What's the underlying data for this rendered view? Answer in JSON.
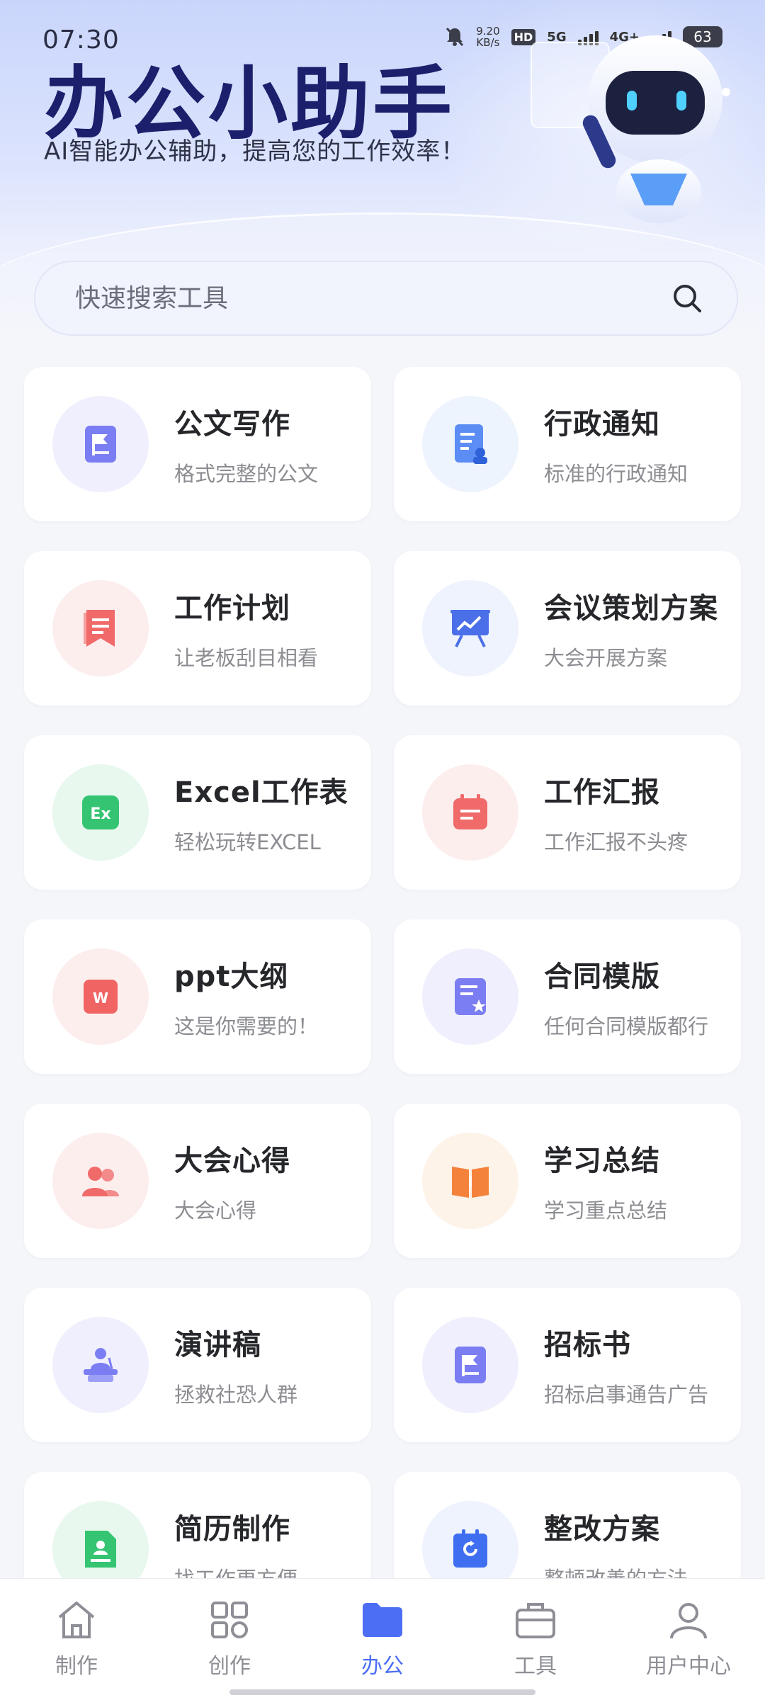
{
  "status": {
    "time": "07:30",
    "net_speed": "9.20",
    "net_unit": "KB/s",
    "hd": "HD",
    "sig1": "5G",
    "sig2": "4G+",
    "battery": "63"
  },
  "header": {
    "title": "办公小助手",
    "subtitle": "AI智能办公辅助，提高您的工作效率！"
  },
  "search": {
    "placeholder": "快速搜索工具"
  },
  "tools": [
    {
      "title": "公文写作",
      "desc": "格式完整的公文",
      "icon": "flag-doc-icon",
      "color": "#7b7df2",
      "bg": "#efeffd"
    },
    {
      "title": "行政通知",
      "desc": "标准的行政通知",
      "icon": "notice-doc-icon",
      "color": "#5b8df5",
      "bg": "#eef4fe"
    },
    {
      "title": "工作计划",
      "desc": "让老板刮目相看",
      "icon": "bookmark-icon",
      "color": "#f06a6a",
      "bg": "#fdeeee"
    },
    {
      "title": "会议策划方案",
      "desc": "大会开展方案",
      "icon": "presentation-icon",
      "color": "#4a6fe8",
      "bg": "#eef3fe"
    },
    {
      "title": "Excel工作表",
      "desc": "轻松玩转EXCEL",
      "icon": "excel-icon",
      "color": "#34c472",
      "bg": "#e8f8ee"
    },
    {
      "title": "工作汇报",
      "desc": "工作汇报不头疼",
      "icon": "report-icon",
      "color": "#f06a6a",
      "bg": "#fdeeee"
    },
    {
      "title": "ppt大纲",
      "desc": "这是你需要的！",
      "icon": "ppt-icon",
      "color": "#f06464",
      "bg": "#fdeeee"
    },
    {
      "title": "合同模版",
      "desc": "任何合同模版都行",
      "icon": "contract-icon",
      "color": "#7b7df2",
      "bg": "#efeffd"
    },
    {
      "title": "大会心得",
      "desc": "大会心得",
      "icon": "people-icon",
      "color": "#f06a6a",
      "bg": "#fdeeee"
    },
    {
      "title": "学习总结",
      "desc": "学习重点总结",
      "icon": "book-icon",
      "color": "#f5823a",
      "bg": "#fef3e8"
    },
    {
      "title": "演讲稿",
      "desc": "拯救社恐人群",
      "icon": "speaker-icon",
      "color": "#7b7df2",
      "bg": "#efeffd"
    },
    {
      "title": "招标书",
      "desc": "招标启事通告广告",
      "icon": "flag-doc-icon",
      "color": "#7b7df2",
      "bg": "#efeffd"
    },
    {
      "title": "简历制作",
      "desc": "找工作更方便",
      "icon": "resume-icon",
      "color": "#34c472",
      "bg": "#e8f8ee"
    },
    {
      "title": "整改方案",
      "desc": "整顿改善的方法",
      "icon": "refresh-doc-icon",
      "color": "#3f6ef0",
      "bg": "#eef3fe"
    }
  ],
  "tabs": [
    {
      "label": "制作",
      "icon": "home-icon",
      "active": false
    },
    {
      "label": "创作",
      "icon": "grid-icon",
      "active": false
    },
    {
      "label": "办公",
      "icon": "folder-icon",
      "active": true
    },
    {
      "label": "工具",
      "icon": "briefcase-icon",
      "active": false
    },
    {
      "label": "用户中心",
      "icon": "user-icon",
      "active": false
    }
  ],
  "colors": {
    "accent": "#4c6ef5",
    "title": "#1c1f6b"
  }
}
